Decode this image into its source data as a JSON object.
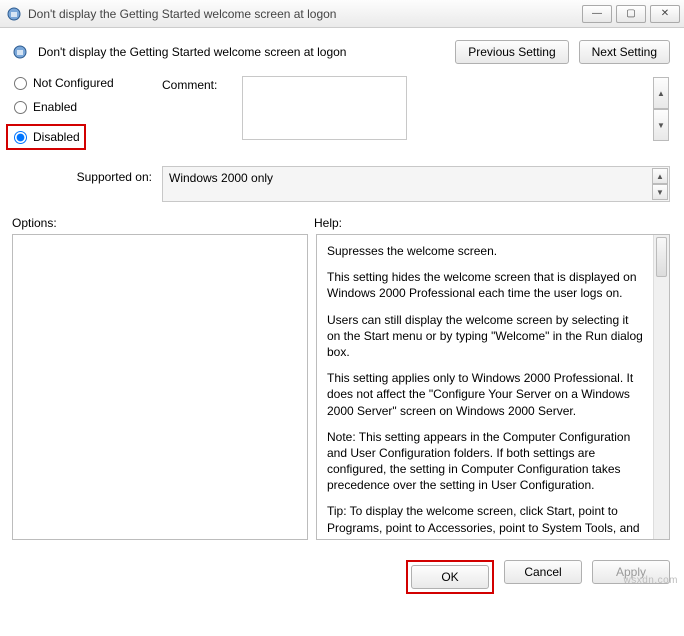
{
  "window": {
    "title": "Don't display the Getting Started welcome screen at logon"
  },
  "header": {
    "policy_title": "Don't display the Getting Started welcome screen at logon",
    "prev_btn": "Previous Setting",
    "next_btn": "Next Setting"
  },
  "radio": {
    "not_configured": "Not Configured",
    "enabled": "Enabled",
    "disabled": "Disabled"
  },
  "fields": {
    "comment_label": "Comment:",
    "comment_value": "",
    "supported_label": "Supported on:",
    "supported_value": "Windows 2000 only"
  },
  "lower": {
    "options_label": "Options:",
    "help_label": "Help:"
  },
  "help": {
    "p1": "Supresses the welcome screen.",
    "p2": "This setting hides the welcome screen that is displayed on Windows 2000 Professional each time the user logs on.",
    "p3": "Users can still display the welcome screen by selecting it on the Start menu or by typing \"Welcome\" in the Run dialog box.",
    "p4": "This setting applies only to Windows 2000 Professional. It does not affect the \"Configure Your Server on a Windows 2000 Server\" screen on Windows 2000 Server.",
    "p5": "Note: This setting appears in the Computer Configuration and User Configuration folders. If both settings are configured, the setting in Computer Configuration takes precedence over the setting in User Configuration.",
    "p6": "Tip: To display the welcome screen, click Start, point to Programs, point to Accessories, point to System Tools, and then click \"Getting Started.\" To suppress the welcome screen without specifying a setting, clear the \"Show this screen at startup\" check"
  },
  "footer": {
    "ok": "OK",
    "cancel": "Cancel",
    "apply": "Apply"
  },
  "watermark": "wsxdn.com"
}
